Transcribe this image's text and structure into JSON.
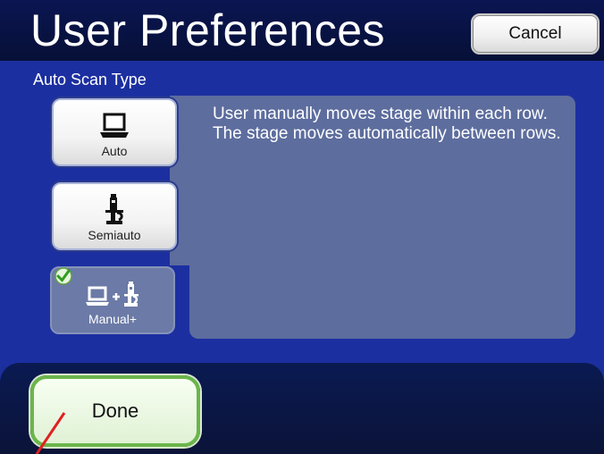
{
  "header": {
    "title": "User Preferences",
    "cancel_label": "Cancel"
  },
  "section": {
    "label": "Auto Scan Type"
  },
  "modes": [
    {
      "label": "Auto",
      "icon": "laptop-icon",
      "selected": false
    },
    {
      "label": "Semiauto",
      "icon": "microscope-icon",
      "selected": false
    },
    {
      "label": "Manual+",
      "icon": "laptop-plus-microscope-icon",
      "selected": true
    }
  ],
  "description": "User manually moves stage within each row.  The stage moves automatically between rows.",
  "footer": {
    "done_label": "Done"
  },
  "colors": {
    "accent_green": "#6bb54c",
    "panel_blue": "#1c2fa0",
    "selected_bg": "#6b7aa6"
  }
}
